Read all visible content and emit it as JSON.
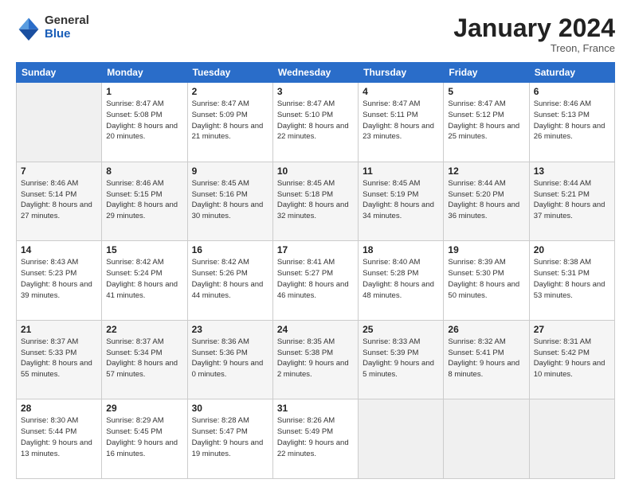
{
  "logo": {
    "general": "General",
    "blue": "Blue"
  },
  "header": {
    "month": "January 2024",
    "location": "Treon, France"
  },
  "weekdays": [
    "Sunday",
    "Monday",
    "Tuesday",
    "Wednesday",
    "Thursday",
    "Friday",
    "Saturday"
  ],
  "weeks": [
    [
      {
        "day": null
      },
      {
        "day": "1",
        "sunrise": "Sunrise: 8:47 AM",
        "sunset": "Sunset: 5:08 PM",
        "daylight": "Daylight: 8 hours and 20 minutes."
      },
      {
        "day": "2",
        "sunrise": "Sunrise: 8:47 AM",
        "sunset": "Sunset: 5:09 PM",
        "daylight": "Daylight: 8 hours and 21 minutes."
      },
      {
        "day": "3",
        "sunrise": "Sunrise: 8:47 AM",
        "sunset": "Sunset: 5:10 PM",
        "daylight": "Daylight: 8 hours and 22 minutes."
      },
      {
        "day": "4",
        "sunrise": "Sunrise: 8:47 AM",
        "sunset": "Sunset: 5:11 PM",
        "daylight": "Daylight: 8 hours and 23 minutes."
      },
      {
        "day": "5",
        "sunrise": "Sunrise: 8:47 AM",
        "sunset": "Sunset: 5:12 PM",
        "daylight": "Daylight: 8 hours and 25 minutes."
      },
      {
        "day": "6",
        "sunrise": "Sunrise: 8:46 AM",
        "sunset": "Sunset: 5:13 PM",
        "daylight": "Daylight: 8 hours and 26 minutes."
      }
    ],
    [
      {
        "day": "7",
        "sunrise": "Sunrise: 8:46 AM",
        "sunset": "Sunset: 5:14 PM",
        "daylight": "Daylight: 8 hours and 27 minutes."
      },
      {
        "day": "8",
        "sunrise": "Sunrise: 8:46 AM",
        "sunset": "Sunset: 5:15 PM",
        "daylight": "Daylight: 8 hours and 29 minutes."
      },
      {
        "day": "9",
        "sunrise": "Sunrise: 8:45 AM",
        "sunset": "Sunset: 5:16 PM",
        "daylight": "Daylight: 8 hours and 30 minutes."
      },
      {
        "day": "10",
        "sunrise": "Sunrise: 8:45 AM",
        "sunset": "Sunset: 5:18 PM",
        "daylight": "Daylight: 8 hours and 32 minutes."
      },
      {
        "day": "11",
        "sunrise": "Sunrise: 8:45 AM",
        "sunset": "Sunset: 5:19 PM",
        "daylight": "Daylight: 8 hours and 34 minutes."
      },
      {
        "day": "12",
        "sunrise": "Sunrise: 8:44 AM",
        "sunset": "Sunset: 5:20 PM",
        "daylight": "Daylight: 8 hours and 36 minutes."
      },
      {
        "day": "13",
        "sunrise": "Sunrise: 8:44 AM",
        "sunset": "Sunset: 5:21 PM",
        "daylight": "Daylight: 8 hours and 37 minutes."
      }
    ],
    [
      {
        "day": "14",
        "sunrise": "Sunrise: 8:43 AM",
        "sunset": "Sunset: 5:23 PM",
        "daylight": "Daylight: 8 hours and 39 minutes."
      },
      {
        "day": "15",
        "sunrise": "Sunrise: 8:42 AM",
        "sunset": "Sunset: 5:24 PM",
        "daylight": "Daylight: 8 hours and 41 minutes."
      },
      {
        "day": "16",
        "sunrise": "Sunrise: 8:42 AM",
        "sunset": "Sunset: 5:26 PM",
        "daylight": "Daylight: 8 hours and 44 minutes."
      },
      {
        "day": "17",
        "sunrise": "Sunrise: 8:41 AM",
        "sunset": "Sunset: 5:27 PM",
        "daylight": "Daylight: 8 hours and 46 minutes."
      },
      {
        "day": "18",
        "sunrise": "Sunrise: 8:40 AM",
        "sunset": "Sunset: 5:28 PM",
        "daylight": "Daylight: 8 hours and 48 minutes."
      },
      {
        "day": "19",
        "sunrise": "Sunrise: 8:39 AM",
        "sunset": "Sunset: 5:30 PM",
        "daylight": "Daylight: 8 hours and 50 minutes."
      },
      {
        "day": "20",
        "sunrise": "Sunrise: 8:38 AM",
        "sunset": "Sunset: 5:31 PM",
        "daylight": "Daylight: 8 hours and 53 minutes."
      }
    ],
    [
      {
        "day": "21",
        "sunrise": "Sunrise: 8:37 AM",
        "sunset": "Sunset: 5:33 PM",
        "daylight": "Daylight: 8 hours and 55 minutes."
      },
      {
        "day": "22",
        "sunrise": "Sunrise: 8:37 AM",
        "sunset": "Sunset: 5:34 PM",
        "daylight": "Daylight: 8 hours and 57 minutes."
      },
      {
        "day": "23",
        "sunrise": "Sunrise: 8:36 AM",
        "sunset": "Sunset: 5:36 PM",
        "daylight": "Daylight: 9 hours and 0 minutes."
      },
      {
        "day": "24",
        "sunrise": "Sunrise: 8:35 AM",
        "sunset": "Sunset: 5:38 PM",
        "daylight": "Daylight: 9 hours and 2 minutes."
      },
      {
        "day": "25",
        "sunrise": "Sunrise: 8:33 AM",
        "sunset": "Sunset: 5:39 PM",
        "daylight": "Daylight: 9 hours and 5 minutes."
      },
      {
        "day": "26",
        "sunrise": "Sunrise: 8:32 AM",
        "sunset": "Sunset: 5:41 PM",
        "daylight": "Daylight: 9 hours and 8 minutes."
      },
      {
        "day": "27",
        "sunrise": "Sunrise: 8:31 AM",
        "sunset": "Sunset: 5:42 PM",
        "daylight": "Daylight: 9 hours and 10 minutes."
      }
    ],
    [
      {
        "day": "28",
        "sunrise": "Sunrise: 8:30 AM",
        "sunset": "Sunset: 5:44 PM",
        "daylight": "Daylight: 9 hours and 13 minutes."
      },
      {
        "day": "29",
        "sunrise": "Sunrise: 8:29 AM",
        "sunset": "Sunset: 5:45 PM",
        "daylight": "Daylight: 9 hours and 16 minutes."
      },
      {
        "day": "30",
        "sunrise": "Sunrise: 8:28 AM",
        "sunset": "Sunset: 5:47 PM",
        "daylight": "Daylight: 9 hours and 19 minutes."
      },
      {
        "day": "31",
        "sunrise": "Sunrise: 8:26 AM",
        "sunset": "Sunset: 5:49 PM",
        "daylight": "Daylight: 9 hours and 22 minutes."
      },
      {
        "day": null
      },
      {
        "day": null
      },
      {
        "day": null
      }
    ]
  ]
}
